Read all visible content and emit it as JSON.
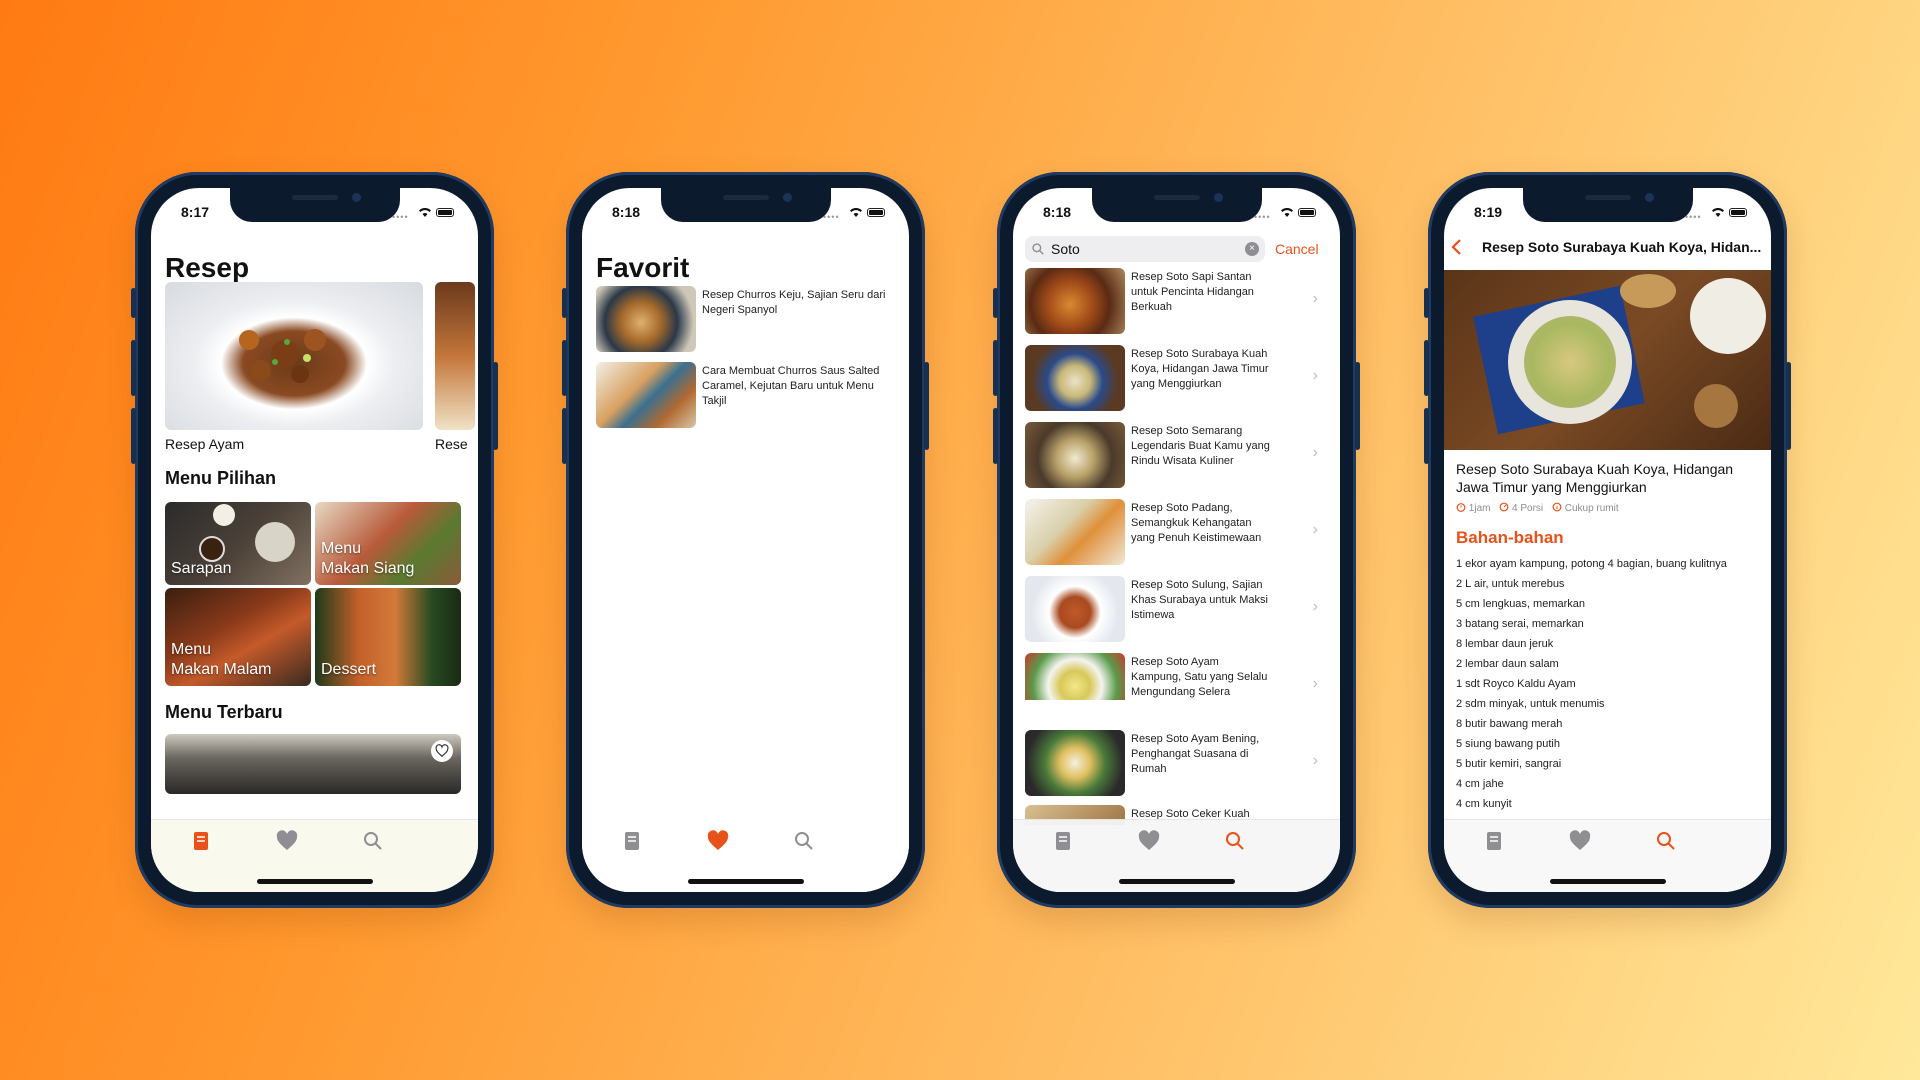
{
  "colors": {
    "accent": "#e8521a",
    "inactive_tab": "#8e8e93",
    "background_start": "#ff7a12",
    "background_end": "#ffe89a"
  },
  "tabs": [
    {
      "name": "resep",
      "icon": "book-icon"
    },
    {
      "name": "favorit",
      "icon": "heart-icon"
    },
    {
      "name": "search",
      "icon": "search-icon"
    }
  ],
  "screen_home": {
    "time": "8:17",
    "title": "Resep",
    "carousel": [
      {
        "label": "Resep Ayam"
      },
      {
        "label": "Rese"
      }
    ],
    "menu_pilihan_title": "Menu Pilihan",
    "menu_pilihan": [
      {
        "label": "Sarapan"
      },
      {
        "label": "Menu\nMakan Siang"
      },
      {
        "label": "Menu\nMakan Malam"
      },
      {
        "label": "Dessert"
      }
    ],
    "menu_terbaru_title": "Menu Terbaru",
    "active_tab": "resep"
  },
  "screen_favorit": {
    "time": "8:18",
    "title": "Favorit",
    "items": [
      {
        "title": "Resep Churros Keju, Sajian Seru dari Negeri Spanyol"
      },
      {
        "title": "Cara Membuat Churros Saus Salted Caramel, Kejutan Baru untuk Menu Takjil"
      }
    ],
    "active_tab": "favorit"
  },
  "screen_search": {
    "time": "8:18",
    "search_value": "Soto",
    "cancel_label": "Cancel",
    "results": [
      {
        "title": "Resep Soto Sapi Santan untuk Pencinta Hidangan Berkuah"
      },
      {
        "title": "Resep Soto Surabaya Kuah Koya, Hidangan Jawa Timur yang Menggiurkan"
      },
      {
        "title": "Resep Soto Semarang Legendaris Buat Kamu yang Rindu Wisata Kuliner"
      },
      {
        "title": "Resep Soto Padang, Semangkuk Kehangatan yang Penuh Keistimewaan"
      },
      {
        "title": "Resep Soto Sulung, Sajian Khas Surabaya untuk Maksi Istimewa"
      },
      {
        "title": "Resep Soto Ayam Kampung, Satu yang Selalu Mengundang Selera"
      },
      {
        "title": "Resep Soto Ayam Bening, Penghangat Suasana di Rumah"
      },
      {
        "title": "Resep Soto Ceker Kuah Kuning"
      }
    ],
    "active_tab": "search"
  },
  "screen_detail": {
    "time": "8:19",
    "nav_title": "Resep Soto Surabaya Kuah Koya, Hidan...",
    "title": "Resep Soto Surabaya Kuah Koya, Hidangan Jawa Timur yang Menggiurkan",
    "meta": {
      "time": "1jam",
      "portion": "4 Porsi",
      "difficulty": "Cukup rumit"
    },
    "ingredients_title": "Bahan-bahan",
    "ingredients": [
      "1 ekor ayam kampung, potong 4 bagian, buang kulitnya",
      "2 L air, untuk merebus",
      "5 cm lengkuas, memarkan",
      "3 batang serai, memarkan",
      "8 lembar daun jeruk",
      "2 lembar daun salam",
      "1 sdt Royco Kaldu Ayam",
      "2 sdm minyak, untuk menumis",
      "8 butir bawang merah",
      "5 siung bawang putih",
      "5 butir kemiri, sangrai",
      "4 cm jahe",
      "4 cm kunyit"
    ],
    "active_tab": "search"
  }
}
